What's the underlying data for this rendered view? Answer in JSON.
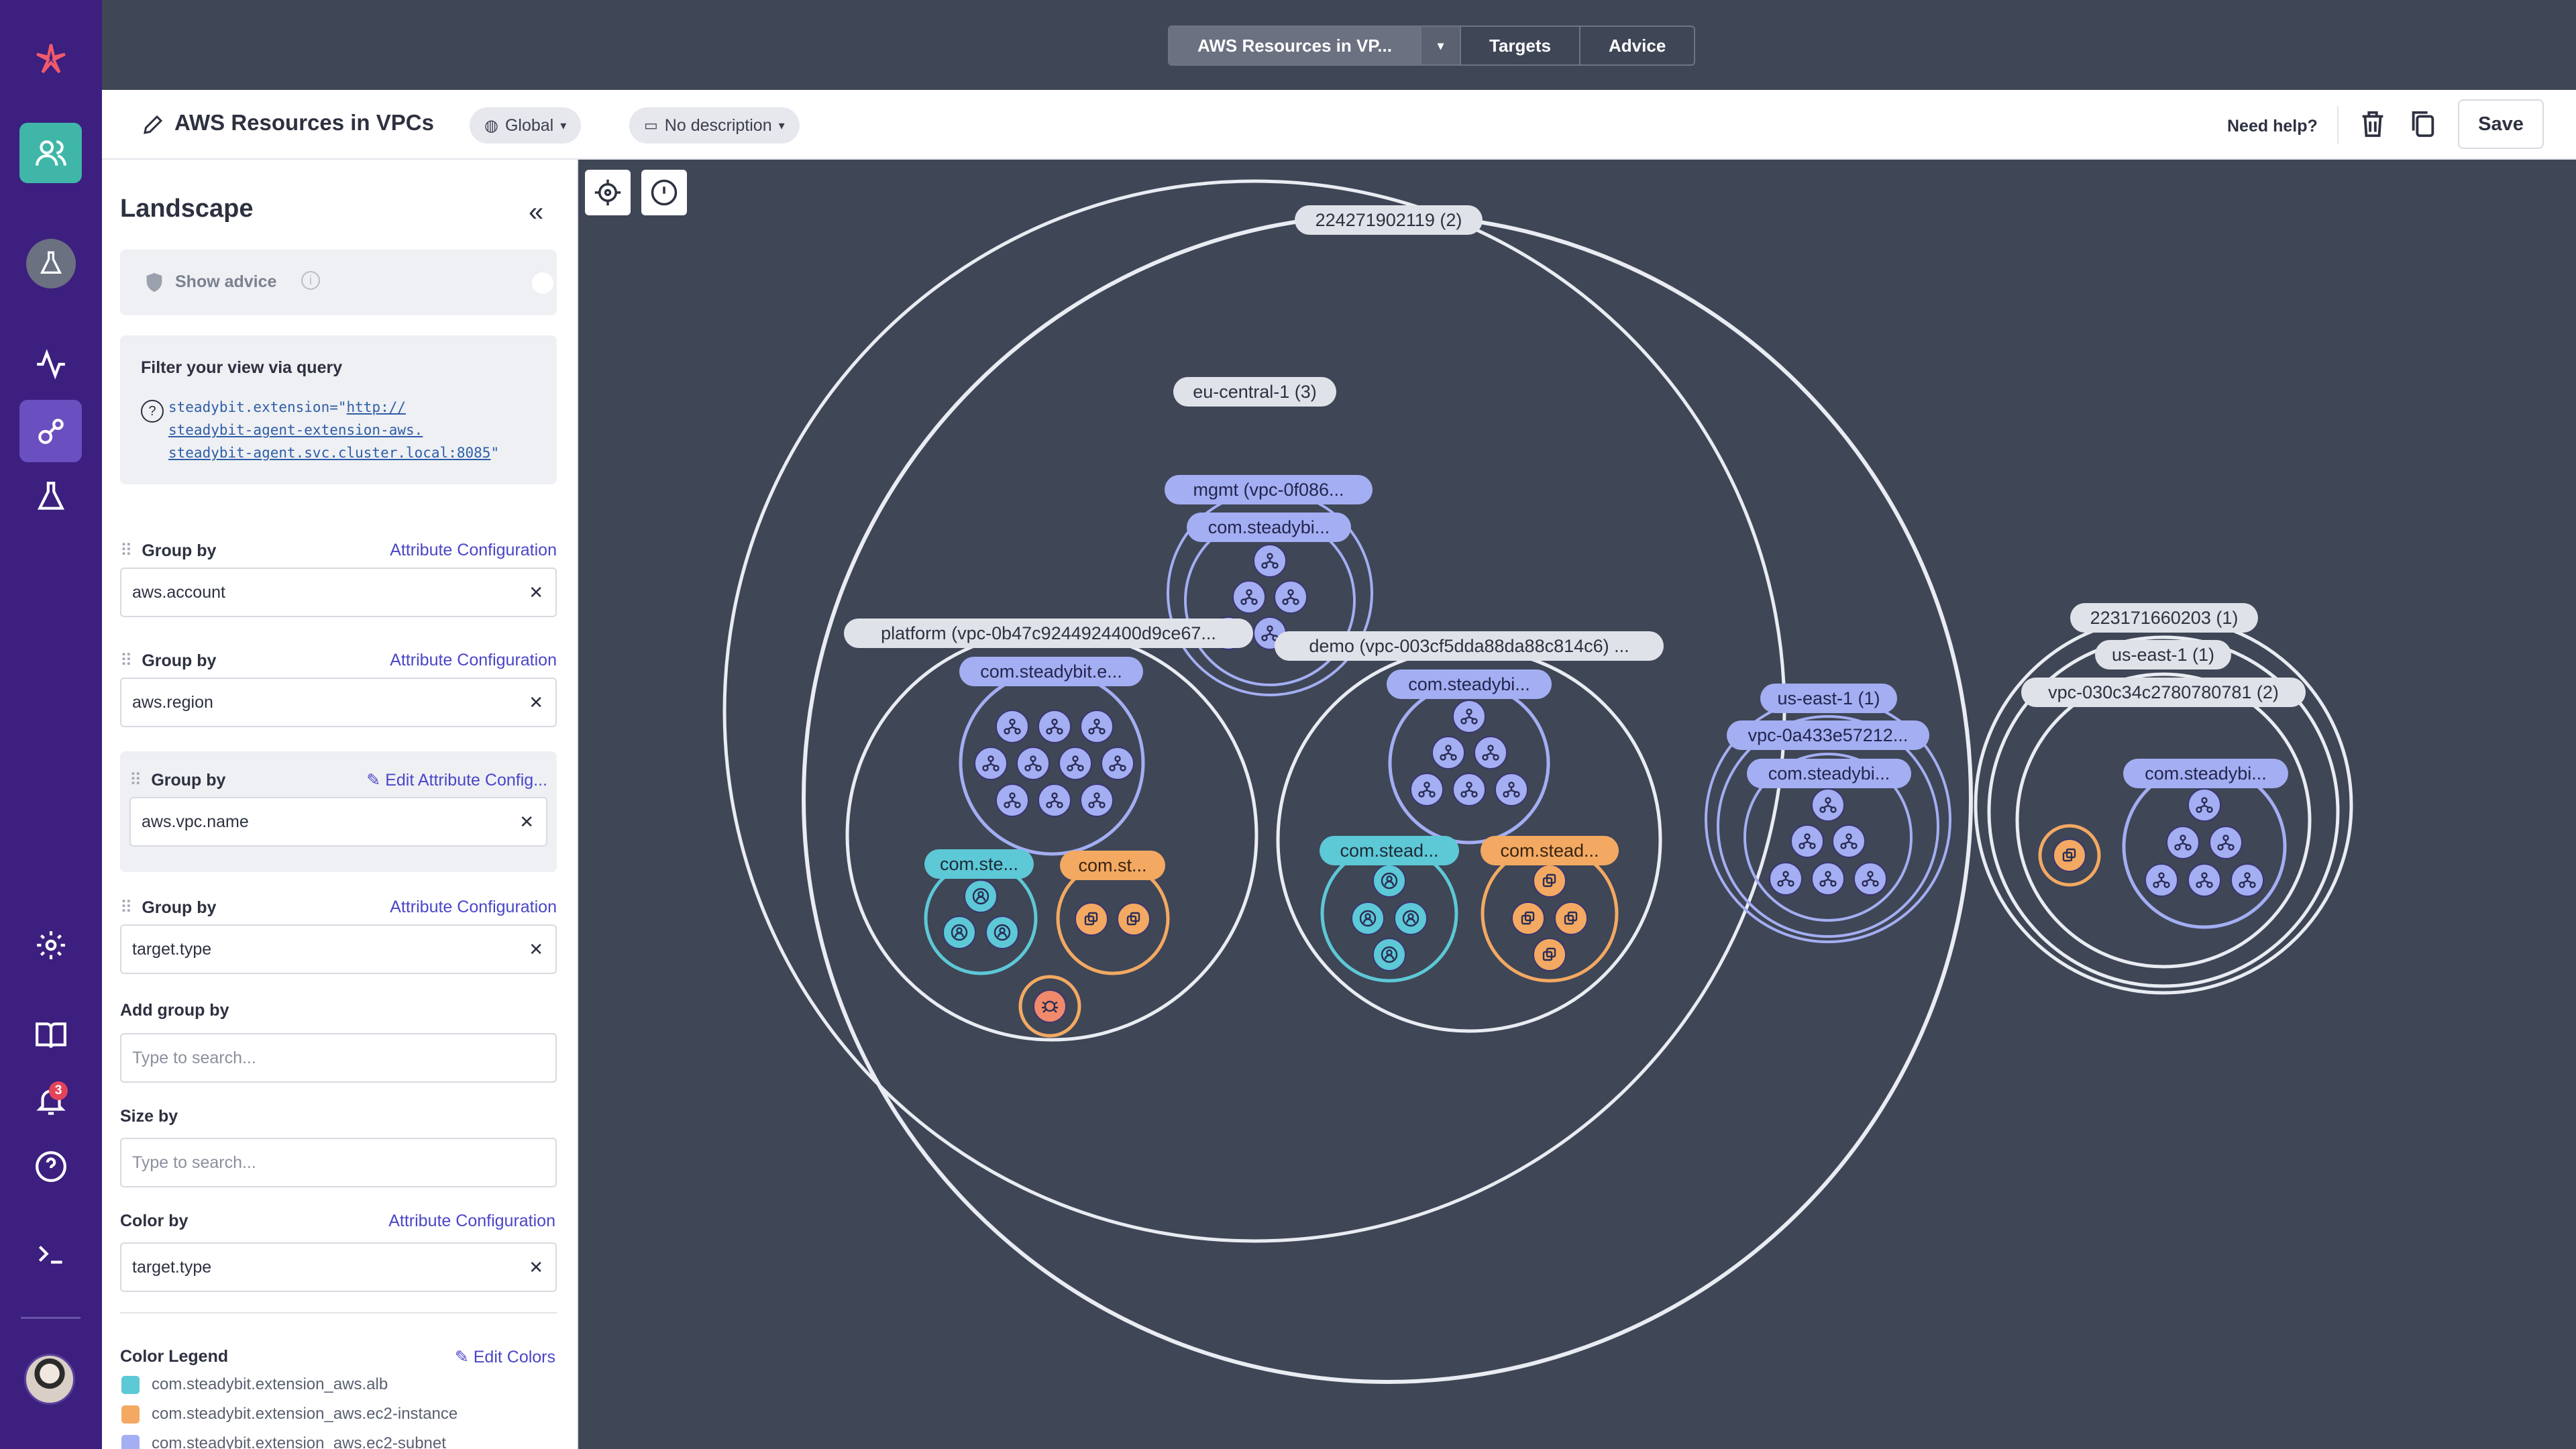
{
  "nav": {
    "items": [
      "logo",
      "targets",
      "experiments-alt",
      "reports",
      "explorer",
      "experiments",
      "settings",
      "docs",
      "notifications",
      "help",
      "terminal"
    ],
    "notification_count": "3",
    "accent": "#3c1f7f",
    "active_item": "explorer"
  },
  "topbar": {
    "tabs": [
      {
        "label": "AWS Resources in VP..."
      },
      {
        "label": "Targets"
      },
      {
        "label": "Advice"
      }
    ]
  },
  "header": {
    "title": "AWS Resources in VPCs",
    "scope": "Global",
    "description": "No description",
    "help": "Need help?",
    "save": "Save"
  },
  "panel": {
    "title": "Landscape",
    "show_advice": "Show advice",
    "filter_heading": "Filter your view via query",
    "query_key": "steadybit.extension=\"",
    "query_value_1": "http://",
    "query_value_2": "steadybit-agent-extension-aws.",
    "query_value_3": "steadybit-agent.svc.cluster.local:8085",
    "query_end": "\"",
    "groups": [
      {
        "label": "Group by",
        "link": "Attribute Configuration",
        "value": "aws.account"
      },
      {
        "label": "Group by",
        "link": "Attribute Configuration",
        "value": "aws.region"
      },
      {
        "label": "Group by",
        "link": "Edit Attribute Config...",
        "value": "aws.vpc.name"
      },
      {
        "label": "Group by",
        "link": "Attribute Configuration",
        "value": "target.type"
      }
    ],
    "add_group_by": "Add group by",
    "add_group_placeholder": "Type to search...",
    "size_by": "Size by",
    "size_placeholder": "Type to search...",
    "color_by": "Color by",
    "color_link": "Attribute Configuration",
    "color_value": "target.type",
    "legend_title": "Color Legend",
    "legend_edit": "Edit Colors",
    "legend": [
      {
        "label": "com.steadybit.extension_aws.alb",
        "color": "#5dc8d6"
      },
      {
        "label": "com.steadybit.extension_aws.ec2-instance",
        "color": "#f3a962"
      },
      {
        "label": "com.steadybit.extension_aws.ec2-subnet",
        "color": "#a4aef2"
      }
    ]
  },
  "landscape": {
    "labels": {
      "account_1": "224271902119 (2)",
      "region_eu": "eu-central-1 (3)",
      "vpc_mgmt": "mgmt (vpc-0f086...",
      "mgmt_subnet": "com.steadybi...",
      "vpc_platform": "platform (vpc-0b47c9244924400d9ce67...",
      "platform_subnet": "com.steadybit.e...",
      "platform_alb": "com.ste...",
      "platform_ec2": "com.st...",
      "vpc_demo": "demo (vpc-003cf5dda88da88c814c6) ...",
      "demo_subnet": "com.steadybi...",
      "demo_alb": "com.stead...",
      "demo_ec2": "com.stead...",
      "region_us1": "us-east-1 (1)",
      "vpc_us1": "vpc-0a433e57212...",
      "us1_subnet": "com.steadybi...",
      "account_2": "223171660203 (1)",
      "region_us2": "us-east-1 (1)",
      "vpc_us2": "vpc-030c34c2780780781 (2)",
      "us2_subnet": "com.steadybi..."
    },
    "colors": {
      "alb": "#5dc8d6",
      "ec2": "#f3a962",
      "subnet": "#a4aef2",
      "other": "#f08a6a",
      "ring": "#e9ecf2"
    }
  }
}
